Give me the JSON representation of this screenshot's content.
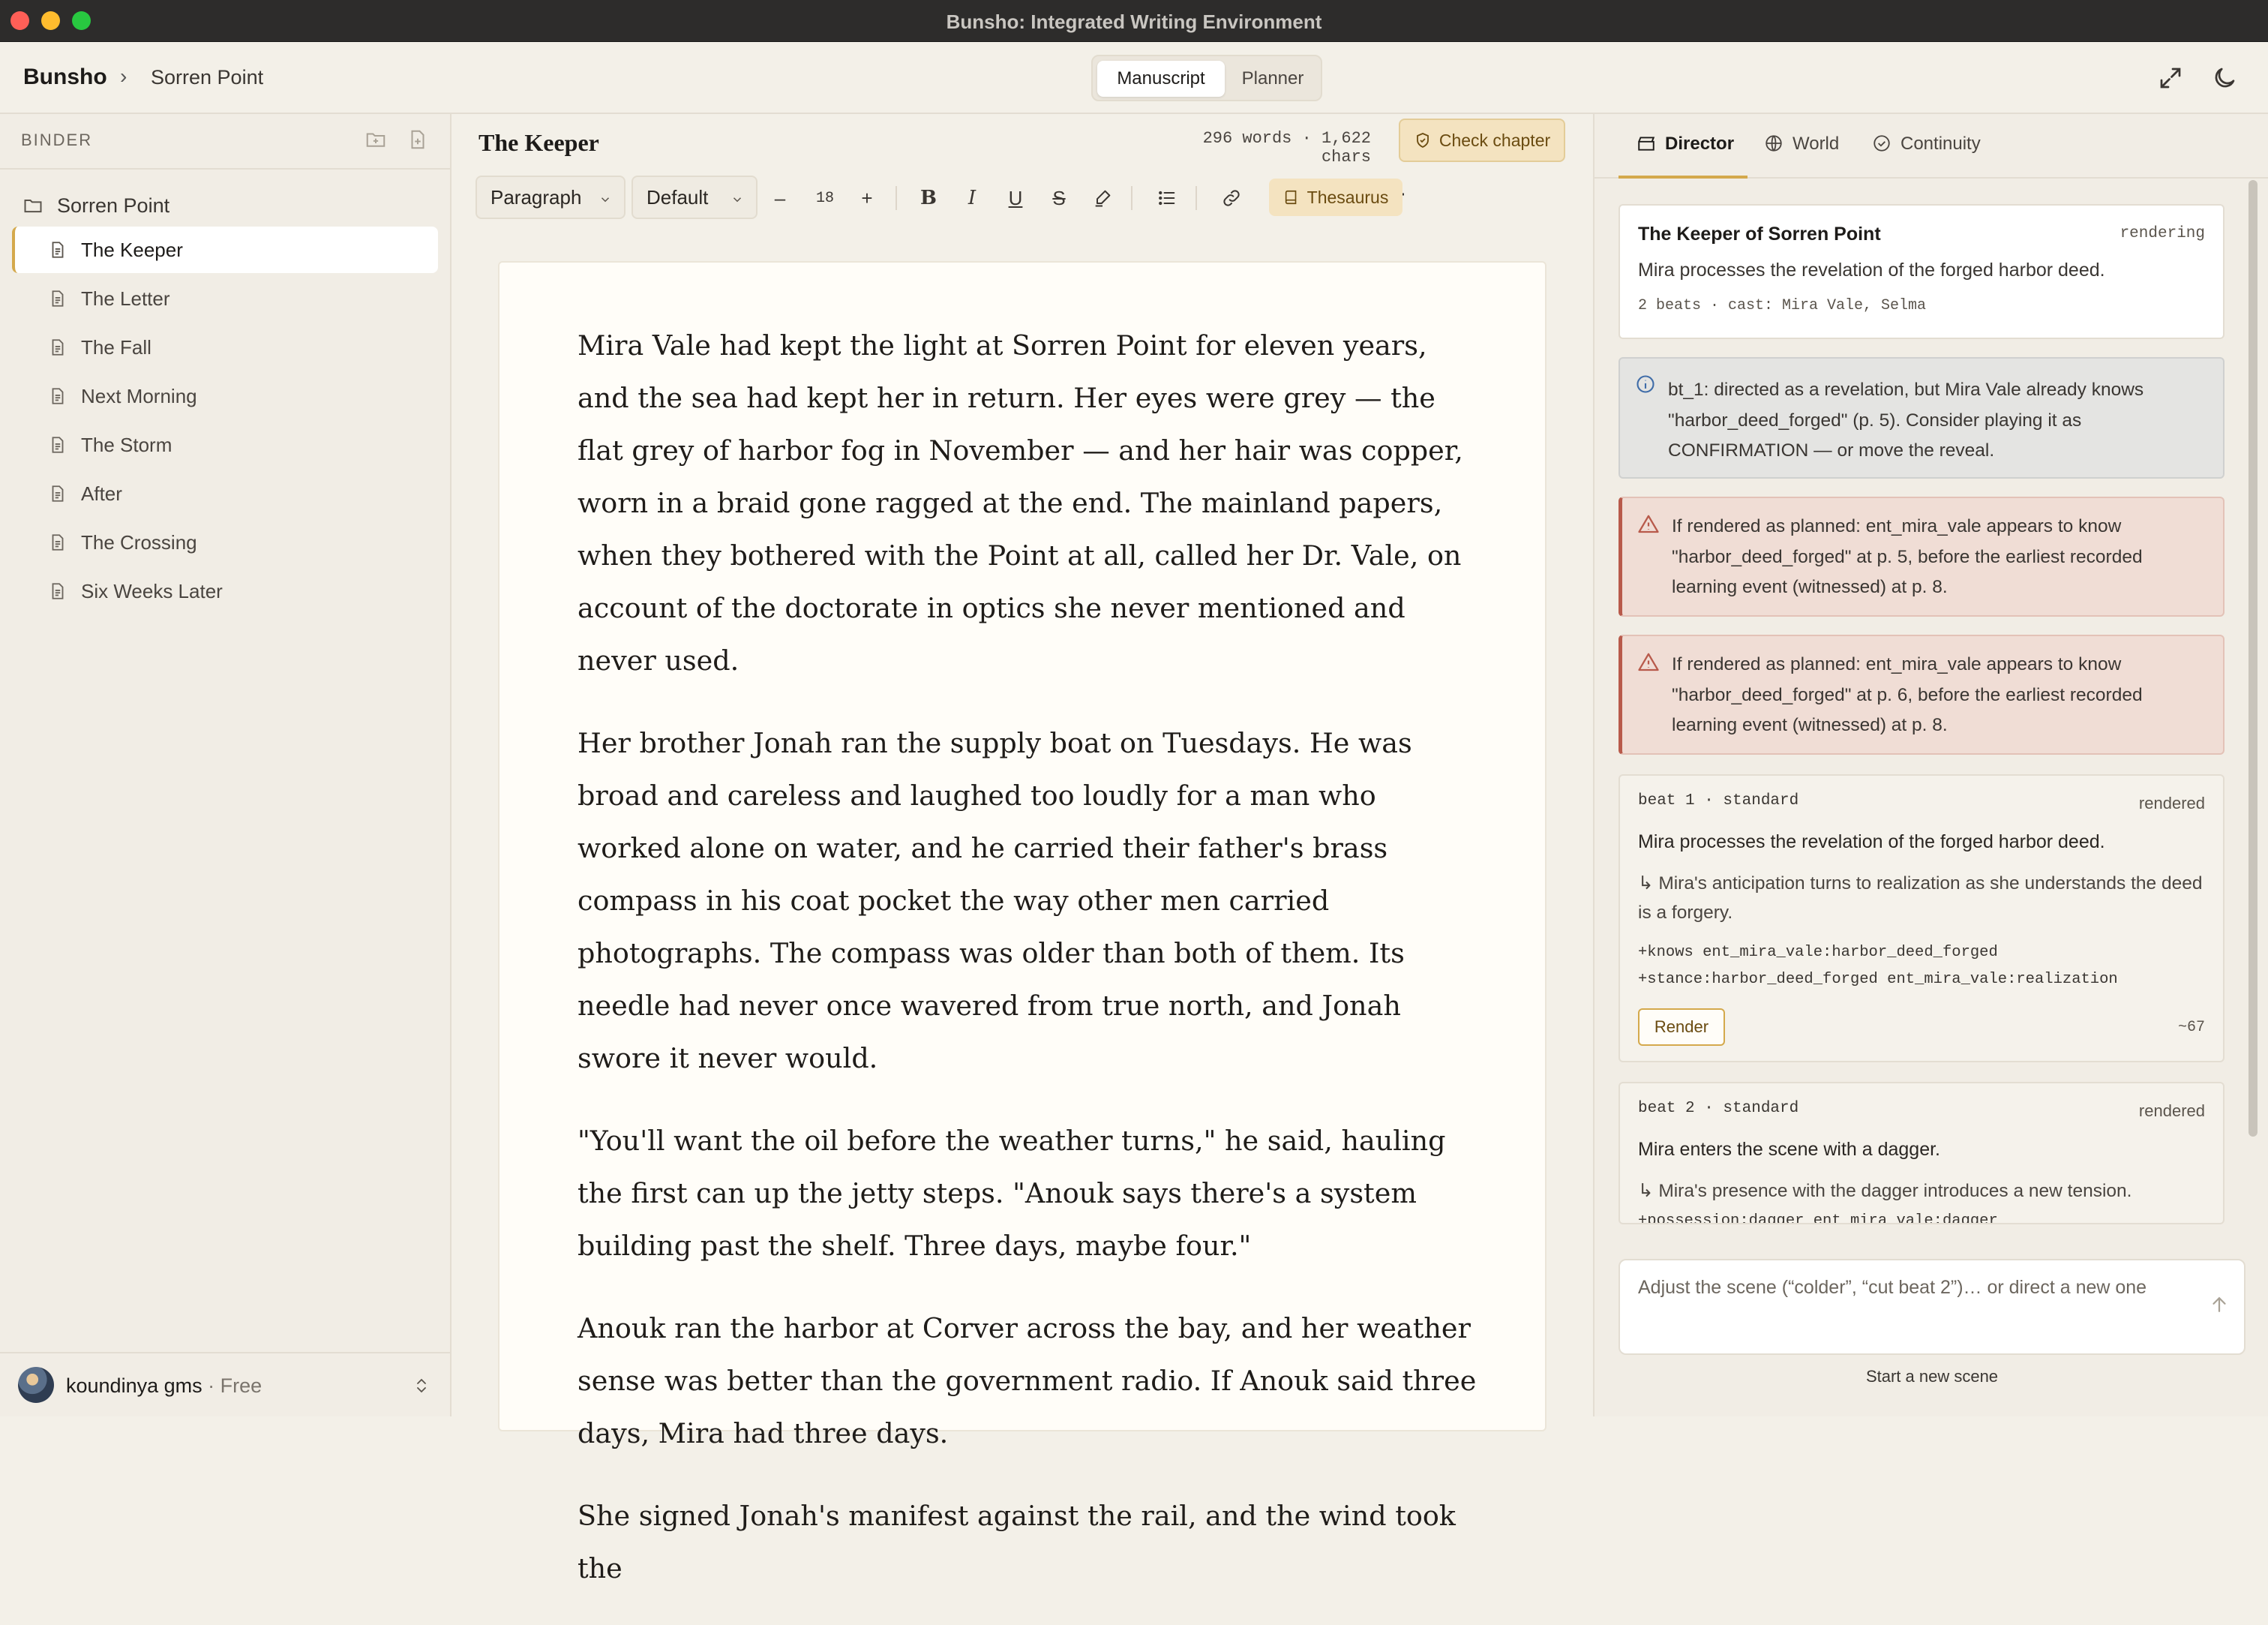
{
  "window": {
    "title": "Bunsho: Integrated Writing Environment"
  },
  "header": {
    "brand": "Bunsho",
    "breadcrumb": "Sorren Point",
    "modes": [
      "Manuscript",
      "Planner"
    ],
    "active_mode": "Manuscript"
  },
  "binder": {
    "heading": "BINDER",
    "root": "Sorren Point",
    "chapters": [
      "The Keeper",
      "The Letter",
      "The Fall",
      "Next Morning",
      "The Storm",
      "After",
      "The Crossing",
      "Six Weeks Later"
    ],
    "selected": "The Keeper"
  },
  "user": {
    "name": "koundinya gms",
    "plan": "· Free"
  },
  "editor": {
    "title": "The Keeper",
    "stats": "296 words · 1,622 chars",
    "check_label": "Check chapter",
    "toolbar": {
      "block_style": "Paragraph",
      "font": "Default",
      "font_size": "18",
      "thesaurus": "Thesaurus"
    },
    "paragraphs": [
      "Mira Vale had kept the light at Sorren Point for eleven years, and the sea had kept her in return. Her eyes were grey — the flat grey of harbor fog in November — and her hair was copper, worn in a braid gone ragged at the end. The mainland papers, when they bothered with the Point at all, called her Dr. Vale, on account of the doctorate in optics she never mentioned and never used.",
      "Her brother Jonah ran the supply boat on Tuesdays. He was broad and careless and laughed too loudly for a man who worked alone on water, and he carried their father's brass compass in his coat pocket the way other men carried photographs. The compass was older than both of them. Its needle had never once wavered from true north, and Jonah swore it never would.",
      "\"You'll want the oil before the weather turns,\" he said, hauling the first can up the jetty steps. \"Anouk says there's a system building past the shelf. Three days, maybe four.\"",
      "Anouk ran the harbor at Corver across the bay, and her weather sense was better than the government radio. If Anouk said three days, Mira had three days.",
      "She signed Jonah's manifest against the rail, and the wind took the"
    ]
  },
  "director": {
    "tabs": [
      "Director",
      "World",
      "Continuity"
    ],
    "active_tab": "Director",
    "scene": {
      "title": "The Keeper of Sorren Point",
      "status": "rendering",
      "summary": "Mira processes the revelation of the forged harbor deed.",
      "meta": "2 beats · cast: Mira Vale, Selma"
    },
    "notice": "bt_1: directed as a revelation, but Mira Vale already knows \"harbor_deed_forged\" (p. 5). Consider playing it as CONFIRMATION — or move the reveal.",
    "warnings": [
      "If rendered as planned: ent_mira_vale appears to know \"harbor_deed_forged\" at p. 5, before the earliest recorded learning event (witnessed) at p. 8.",
      "If rendered as planned: ent_mira_vale appears to know \"harbor_deed_forged\" at p. 6, before the earliest recorded learning event (witnessed) at p. 8."
    ],
    "beats": [
      {
        "header": "beat 1 · standard",
        "status": "rendered",
        "desc": "Mira processes the revelation of the forged harbor deed.",
        "outcome": "↳ Mira's anticipation turns to realization as she understands the deed is a forgery.",
        "effects": [
          "+knows ent_mira_vale:harbor_deed_forged",
          "+stance:harbor_deed_forged ent_mira_vale:realization"
        ],
        "button": "Render",
        "tokens": "~67"
      },
      {
        "header": "beat 2 · standard",
        "status": "rendered",
        "desc": "Mira enters the scene with a dagger.",
        "outcome": "↳ Mira's presence with the dagger introduces a new tension.",
        "effects": [
          "+possession:dagger ent_mira_vale:dagger"
        ]
      }
    ],
    "prompt_placeholder": "Adjust the scene (“colder”, “cut beat 2”)… or direct a new one",
    "new_scene": "Start a new scene"
  },
  "colors": {
    "accent": "#d4a94c",
    "warning": "#b85a4b",
    "background": "#f3f0e8"
  }
}
